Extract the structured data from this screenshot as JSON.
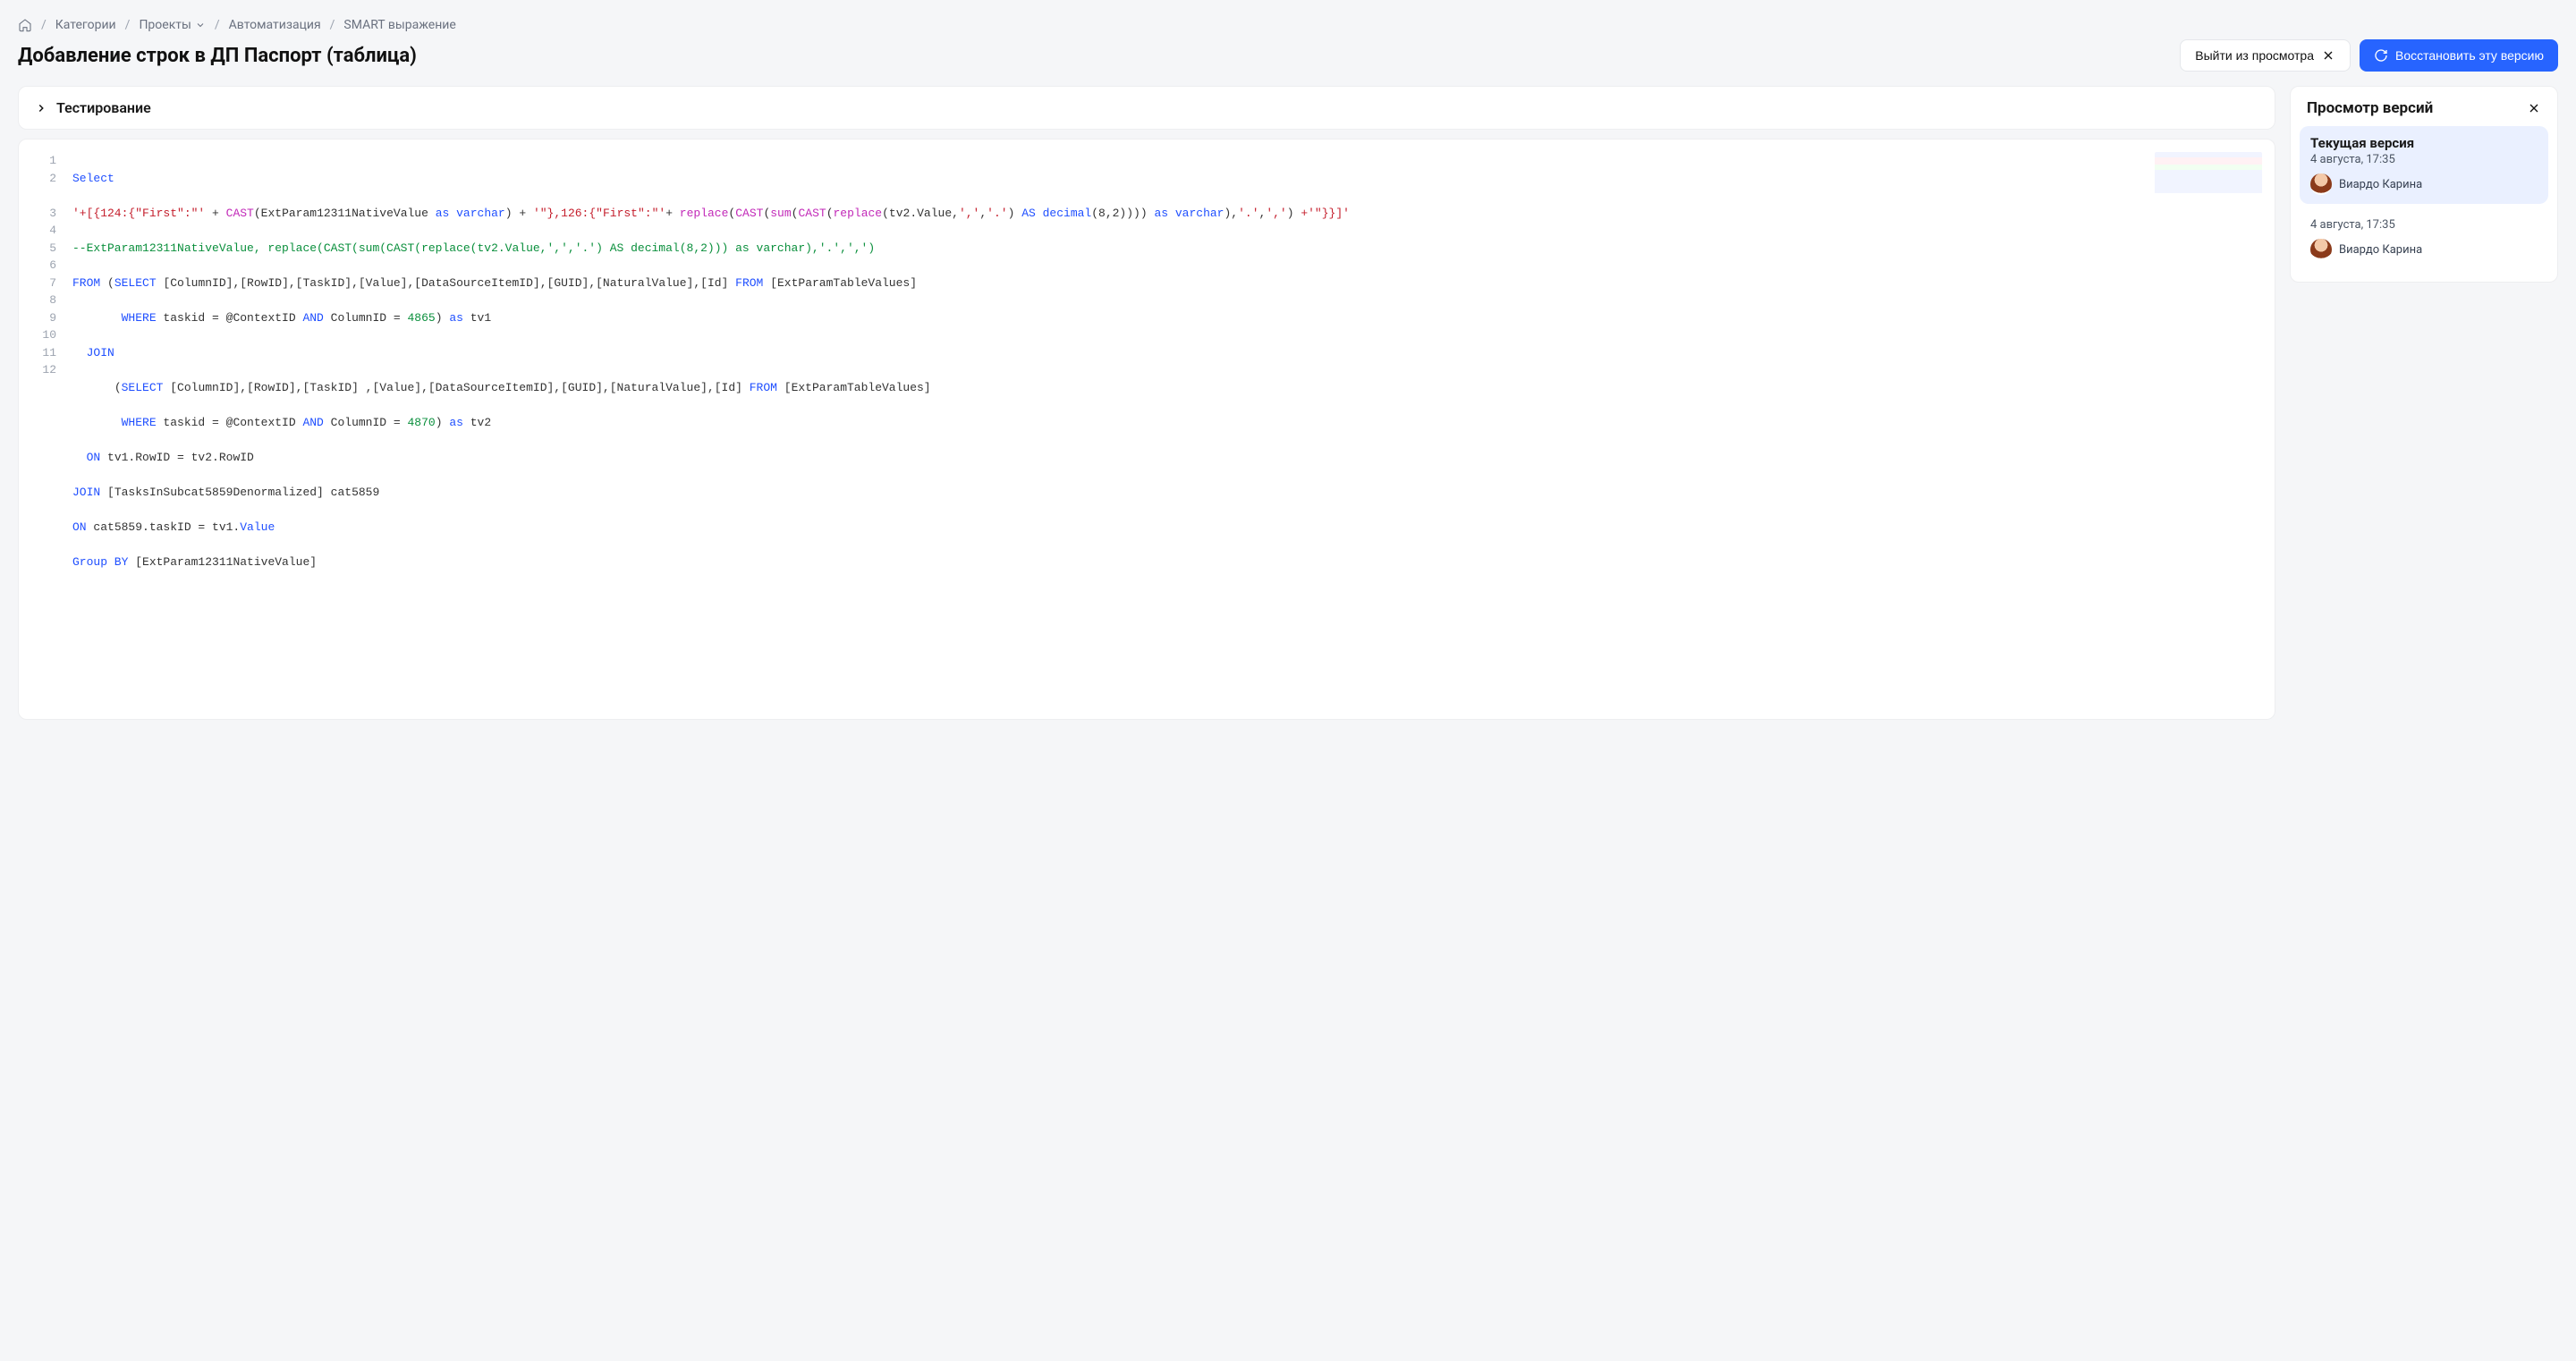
{
  "breadcrumbs": {
    "categories": "Категории",
    "projects": "Проекты",
    "automation": "Автоматизация",
    "smart": "SMART выражение"
  },
  "page_title": "Добавление строк в ДП Паспорт (таблица)",
  "actions": {
    "exit_view": "Выйти из просмотра",
    "restore": "Восстановить эту версию"
  },
  "collapse": {
    "testing": "Тестирование"
  },
  "sidebar": {
    "title": "Просмотр версий",
    "versions": [
      {
        "title": "Текущая версия",
        "date": "4 августа, 17:35",
        "user": "Виардо Карина",
        "active": true
      },
      {
        "title": "",
        "date": "4 августа, 17:35",
        "user": "Виардо Карина",
        "active": false
      }
    ]
  },
  "code": {
    "lines": [
      {
        "n": 1,
        "wrap": false
      },
      {
        "n": 2,
        "wrap": true
      },
      {
        "n": 3,
        "wrap": false
      },
      {
        "n": 4,
        "wrap": false
      },
      {
        "n": 5,
        "wrap": false
      },
      {
        "n": 6,
        "wrap": false
      },
      {
        "n": 7,
        "wrap": false
      },
      {
        "n": 8,
        "wrap": false
      },
      {
        "n": 9,
        "wrap": false
      },
      {
        "n": 10,
        "wrap": false
      },
      {
        "n": 11,
        "wrap": false
      },
      {
        "n": 12,
        "wrap": false
      }
    ],
    "tokens": {
      "select": "Select",
      "l2_s1": "'+[{124:{\"First\":\"'",
      "plus": " + ",
      "cast": "CAST",
      "lp": "(",
      "rp": ")",
      "ext_native": "ExtParam12311NativeValue",
      "as": " as ",
      "varchar": "varchar",
      "l2_s2": "'\"},126:{\"First\":\"'",
      "replace": "replace",
      "sum": "sum",
      "tv2val": "tv2.Value",
      "comma_lit": "','",
      "dot_lit": "'.'",
      "space_as": " AS ",
      "decimal": "decimal",
      "d82": "(8,2)",
      "triple_rp": ")))",
      "l2_end": " +'\"}}]'",
      "comment3": "--ExtParam12311NativeValue, replace(CAST(sum(CAST(replace(tv2.Value,',','.') AS decimal(8,2))) as varchar),'.',',')",
      "from": "FROM",
      "select_u": "SELECT",
      "cols": " [ColumnID],[RowID],[TaskID],[Value],[DataSourceItemID],[GUID],[NaturalValue],[Id] ",
      "cols2": " [ColumnID],[RowID],[TaskID] ,[Value],[DataSourceItemID],[GUID],[NaturalValue],[Id] ",
      "tbl": "[ExtParamTableValues]",
      "where": "WHERE",
      "taskid_eq": " taskid = @ContextID ",
      "and": "AND",
      "colid_eq1": " ColumnID = ",
      "n4865": "4865",
      "n4870": "4870",
      "as_tv1": " tv1",
      "as_tv2": " tv2",
      "join": "JOIN",
      "on": "ON",
      "on_row": " tv1.RowID = tv2.RowID",
      "join_tbl": " [TasksInSubcat5859Denormalized] cat5859",
      "on2": " cat5859.taskID = tv1.",
      "value": "Value",
      "group_by": "Group BY",
      "gb_col": " [ExtParam12311NativeValue]"
    }
  }
}
